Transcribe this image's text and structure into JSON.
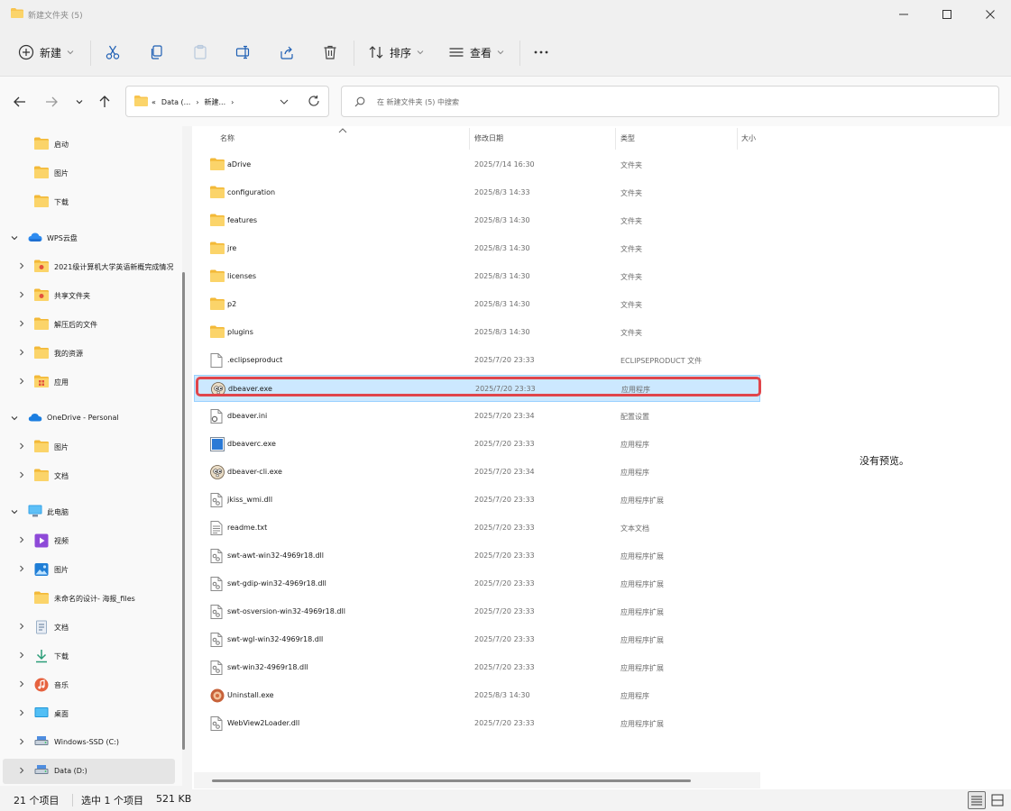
{
  "window": {
    "title": "新建文件夹 (5)"
  },
  "toolbar": {
    "new_label": "新建",
    "sort_label": "排序",
    "view_label": "查看"
  },
  "address": {
    "crumbs": [
      "Data (...",
      "新建..."
    ],
    "search_placeholder": "在 新建文件夹 (5) 中搜索"
  },
  "sidebar": {
    "items": [
      {
        "label": "启动",
        "icon": "folder-icon"
      },
      {
        "label": "图片",
        "icon": "folder-icon"
      },
      {
        "label": "下载",
        "icon": "folder-icon"
      },
      {
        "label": "WPS云盘",
        "icon": "cloud-icon"
      },
      {
        "label": "2021级计算机大学英语新概完成情况",
        "icon": "shared-folder-icon"
      },
      {
        "label": "共享文件夹",
        "icon": "shared-folder-icon"
      },
      {
        "label": "解压后的文件",
        "icon": "folder-icon"
      },
      {
        "label": "我的资源",
        "icon": "folder-icon"
      },
      {
        "label": "应用",
        "icon": "apps-folder-icon"
      },
      {
        "label": "OneDrive - Personal",
        "icon": "onedrive-icon"
      },
      {
        "label": "图片",
        "icon": "folder-icon"
      },
      {
        "label": "文档",
        "icon": "folder-icon"
      },
      {
        "label": "此电脑",
        "icon": "pc-icon"
      },
      {
        "label": "视频",
        "icon": "video-icon"
      },
      {
        "label": "图片",
        "icon": "pictures-icon"
      },
      {
        "label": "未命名的设计- 海报_files",
        "icon": "folder-icon"
      },
      {
        "label": "文档",
        "icon": "documents-icon"
      },
      {
        "label": "下载",
        "icon": "download-icon"
      },
      {
        "label": "音乐",
        "icon": "music-icon"
      },
      {
        "label": "桌面",
        "icon": "desktop-icon"
      },
      {
        "label": "Windows-SSD (C:)",
        "icon": "drive-icon"
      },
      {
        "label": "Data (D:)",
        "icon": "drive-icon"
      }
    ]
  },
  "columns": {
    "name": "名称",
    "date": "修改日期",
    "type": "类型",
    "size": "大小"
  },
  "files": [
    {
      "name": "aDrive",
      "date": "2025/7/14 16:30",
      "type": "文件夹",
      "icon": "folder-icon"
    },
    {
      "name": "configuration",
      "date": "2025/8/3 14:33",
      "type": "文件夹",
      "icon": "folder-icon"
    },
    {
      "name": "features",
      "date": "2025/8/3 14:30",
      "type": "文件夹",
      "icon": "folder-icon"
    },
    {
      "name": "jre",
      "date": "2025/8/3 14:30",
      "type": "文件夹",
      "icon": "folder-icon"
    },
    {
      "name": "licenses",
      "date": "2025/8/3 14:30",
      "type": "文件夹",
      "icon": "folder-icon"
    },
    {
      "name": "p2",
      "date": "2025/8/3 14:30",
      "type": "文件夹",
      "icon": "folder-icon"
    },
    {
      "name": "plugins",
      "date": "2025/8/3 14:30",
      "type": "文件夹",
      "icon": "folder-icon"
    },
    {
      "name": ".eclipseproduct",
      "date": "2025/7/20 23:33",
      "type": "ECLIPSEPRODUCT 文件",
      "icon": "blank-file-icon"
    },
    {
      "name": "dbeaver.exe",
      "date": "2025/7/20 23:33",
      "type": "应用程序",
      "icon": "dbeaver-icon"
    },
    {
      "name": "dbeaver.ini",
      "date": "2025/7/20 23:34",
      "type": "配置设置",
      "icon": "settings-file-icon"
    },
    {
      "name": "dbeaverc.exe",
      "date": "2025/7/20 23:33",
      "type": "应用程序",
      "icon": "app-window-icon"
    },
    {
      "name": "dbeaver-cli.exe",
      "date": "2025/7/20 23:34",
      "type": "应用程序",
      "icon": "dbeaver-icon"
    },
    {
      "name": "jkiss_wmi.dll",
      "date": "2025/7/20 23:33",
      "type": "应用程序扩展",
      "icon": "dll-file-icon"
    },
    {
      "name": "readme.txt",
      "date": "2025/7/20 23:33",
      "type": "文本文档",
      "icon": "text-file-icon"
    },
    {
      "name": "swt-awt-win32-4969r18.dll",
      "date": "2025/7/20 23:33",
      "type": "应用程序扩展",
      "icon": "dll-file-icon"
    },
    {
      "name": "swt-gdip-win32-4969r18.dll",
      "date": "2025/7/20 23:33",
      "type": "应用程序扩展",
      "icon": "dll-file-icon"
    },
    {
      "name": "swt-osversion-win32-4969r18.dll",
      "date": "2025/7/20 23:33",
      "type": "应用程序扩展",
      "icon": "dll-file-icon"
    },
    {
      "name": "swt-wgl-win32-4969r18.dll",
      "date": "2025/7/20 23:33",
      "type": "应用程序扩展",
      "icon": "dll-file-icon"
    },
    {
      "name": "swt-win32-4969r18.dll",
      "date": "2025/7/20 23:33",
      "type": "应用程序扩展",
      "icon": "dll-file-icon"
    },
    {
      "name": "Uninstall.exe",
      "date": "2025/8/3 14:30",
      "type": "应用程序",
      "icon": "uninstall-icon"
    },
    {
      "name": "WebView2Loader.dll",
      "date": "2025/7/20 23:33",
      "type": "应用程序扩展",
      "icon": "dll-file-icon"
    }
  ],
  "selected_file": "dbeaver.exe",
  "preview": {
    "text": "没有预览。"
  },
  "status": {
    "count": "21 个项目",
    "selected": "选中 1 个项目",
    "size": "521 KB"
  },
  "colors": {
    "accent": "#0067c0",
    "folder": "#f8c44f",
    "selection": "#cce8ff",
    "highlight": "#e0454b"
  }
}
